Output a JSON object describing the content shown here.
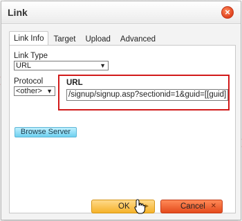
{
  "dialog": {
    "title": "Link",
    "close_icon": "close-icon"
  },
  "tabs": [
    {
      "label": "Link Info",
      "active": true
    },
    {
      "label": "Target",
      "active": false
    },
    {
      "label": "Upload",
      "active": false
    },
    {
      "label": "Advanced",
      "active": false
    }
  ],
  "link_type": {
    "label": "Link Type",
    "value": "URL"
  },
  "protocol": {
    "label": "Protocol",
    "value": "<other>"
  },
  "url": {
    "label": "URL",
    "value": "/signup/signup.asp?sectionid=1&guid=[[guid]"
  },
  "buttons": {
    "browse": "Browse Server",
    "ok": "OK",
    "cancel": "Cancel"
  },
  "colors": {
    "highlight_border": "#d11919",
    "ok_accent": "#f5b22a",
    "cancel_accent": "#e44a1c",
    "browse_accent": "#6fd0ef"
  }
}
